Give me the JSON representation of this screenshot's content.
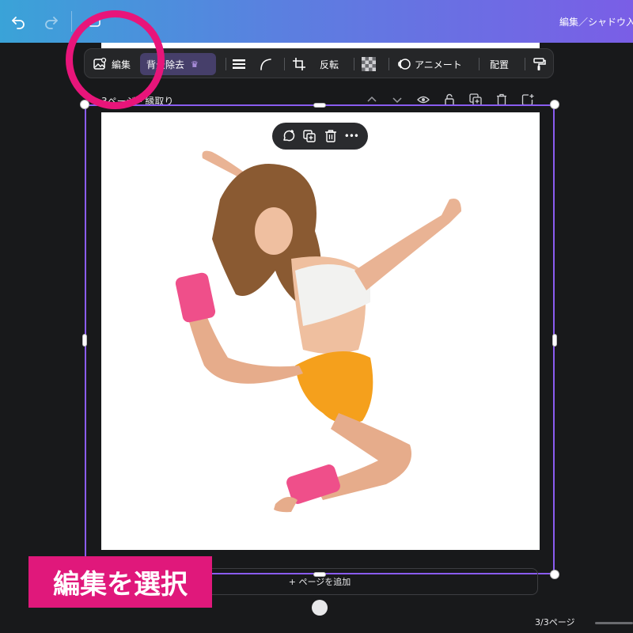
{
  "topbar": {
    "title": "編集／シャドウ入",
    "icons": [
      "undo-icon",
      "redo-icon",
      "cloud-save-icon"
    ]
  },
  "toolbar": {
    "edit_label": "編集",
    "bg_remove_label": "背景除去",
    "bg_remove_badge": "♛",
    "flip_label": "反転",
    "animate_label": "アニメート",
    "arrange_label": "配置",
    "icons": [
      "image-edit-icon",
      "border-lines-icon",
      "corner-radius-icon",
      "crop-icon",
      "transparency-icon",
      "animate-icon",
      "paint-roller-icon"
    ]
  },
  "page": {
    "label": "3ページ - 縁取り",
    "actions": [
      "chevron-up-icon",
      "chevron-down-icon",
      "hide-icon",
      "lock-icon",
      "duplicate-page-icon",
      "delete-page-icon",
      "add-page-icon"
    ]
  },
  "pill": {
    "icons": [
      "comment-add-icon",
      "duplicate-icon",
      "trash-icon",
      "more-icon"
    ],
    "more_label": "•••"
  },
  "add_page_label": "+ ページを追加",
  "page_count": "3/3ページ",
  "callout": "編集を選択",
  "colors": {
    "accent": "#8a5cf0",
    "annotation": "#e0187b",
    "toolbar_bg": "#252628",
    "canvas_bg": "#18191b"
  }
}
